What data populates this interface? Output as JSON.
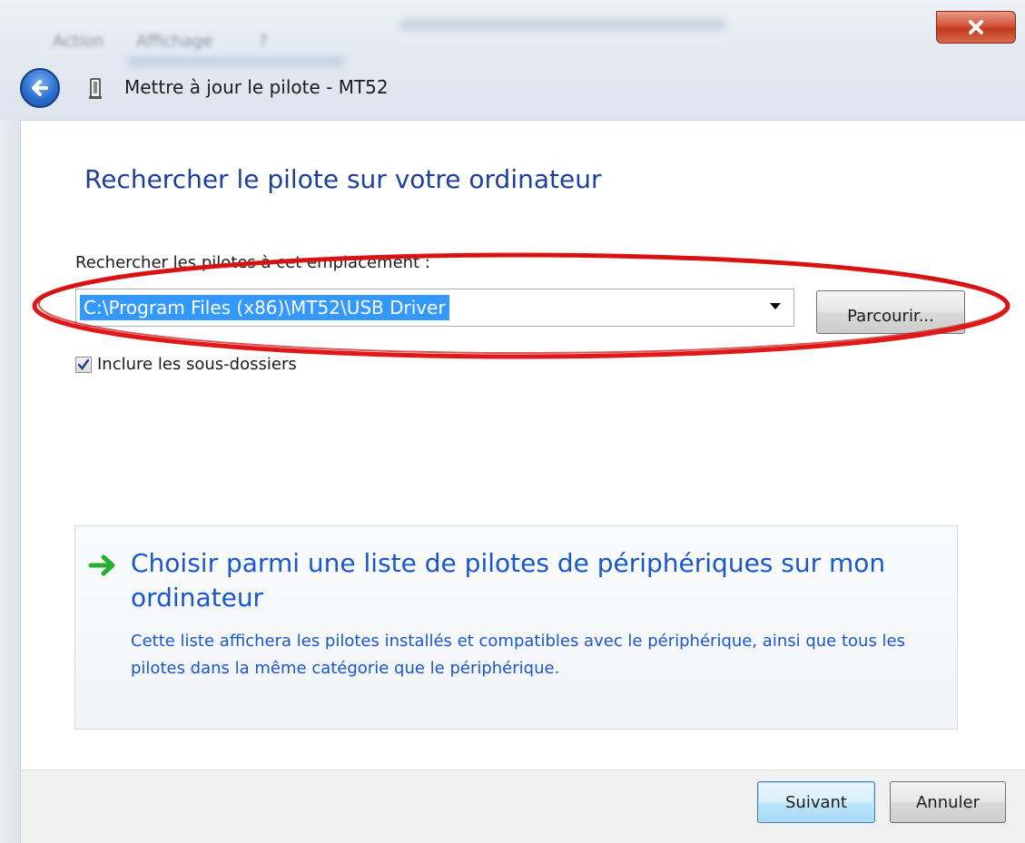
{
  "window": {
    "title": "Mettre à jour le pilote - MT52",
    "background_menu": [
      "Action",
      "Affichage",
      "?"
    ]
  },
  "content": {
    "heading": "Rechercher le pilote sur votre ordinateur",
    "location_label": "Rechercher les pilotes à cet emplacement :",
    "path_value": "C:\\Program Files (x86)\\MT52\\USB Driver",
    "browse_label": "Parcourir...",
    "include_subfolders": {
      "label": "Inclure les sous-dossiers",
      "checked": true
    },
    "choice": {
      "title": "Choisir parmi une liste de pilotes de périphériques sur mon ordinateur",
      "description": "Cette liste affichera les pilotes installés et compatibles avec le périphérique, ainsi que tous les pilotes dans la même catégorie que le périphérique."
    }
  },
  "footer": {
    "next_label": "Suivant",
    "cancel_label": "Annuler"
  },
  "icons": {
    "close": "close-icon",
    "back": "back-arrow-icon",
    "device": "usb-device-icon",
    "choice_arrow": "green-arrow-icon",
    "check": "checkmark-icon",
    "dropdown": "dropdown-arrow-icon"
  },
  "colors": {
    "heading": "#1e3f9e",
    "link": "#1957d1",
    "selection": "#3399ff",
    "annotation": "#e01818",
    "close": "#c03a1e"
  }
}
